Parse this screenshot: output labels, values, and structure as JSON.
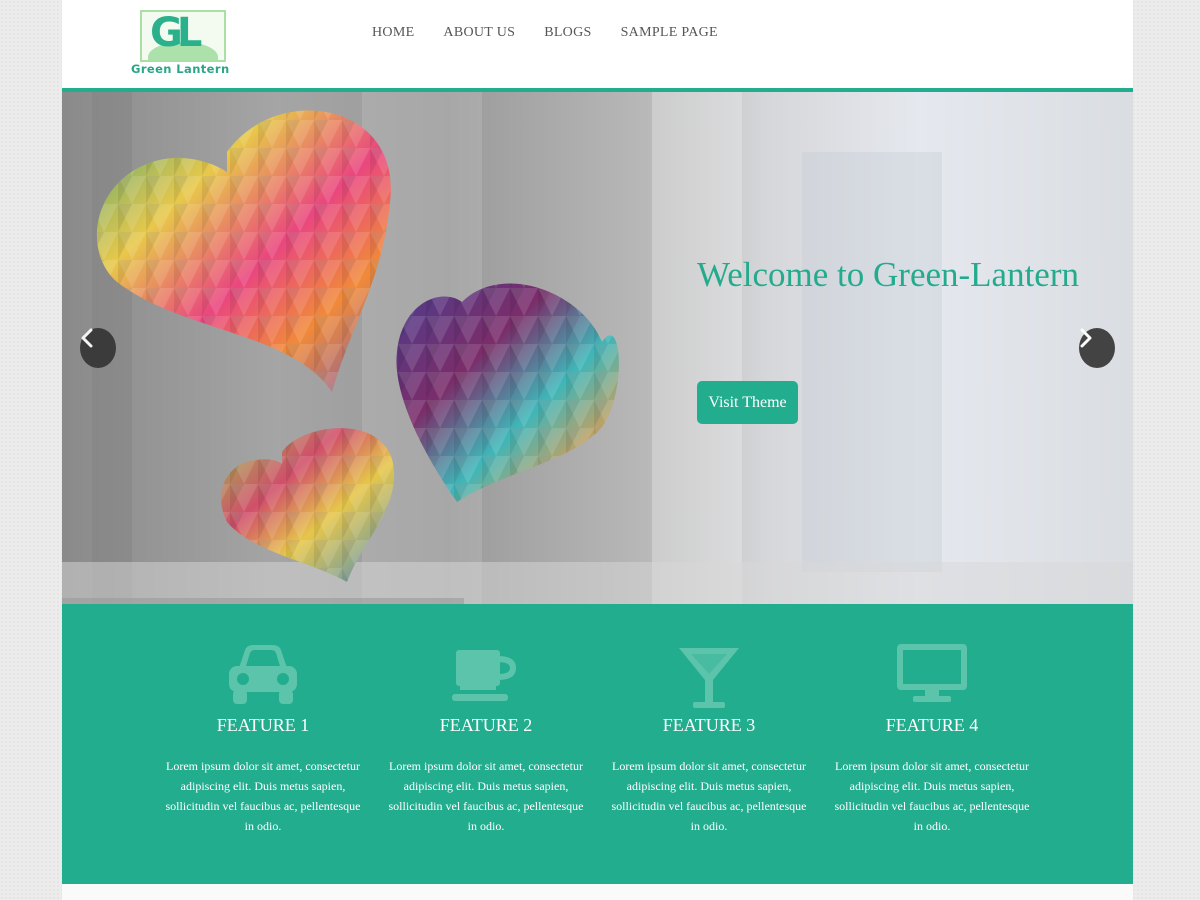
{
  "logo": {
    "letters": "GL",
    "text": "Green Lantern"
  },
  "nav": {
    "items": [
      "HOME",
      "ABOUT US",
      "BLOGS",
      "SAMPLE PAGE"
    ]
  },
  "hero": {
    "title": "Welcome to Green-Lantern",
    "button_label": "Visit Theme"
  },
  "features": [
    {
      "icon": "car-icon",
      "title": "FEATURE 1",
      "text": "Lorem ipsum dolor sit amet, consectetur adipiscing elit. Duis metus sapien, sollicitudin vel faucibus ac, pellentesque in odio."
    },
    {
      "icon": "coffee-cup-icon",
      "title": "FEATURE 2",
      "text": "Lorem ipsum dolor sit amet, consectetur adipiscing elit. Duis metus sapien, sollicitudin vel faucibus ac, pellentesque in odio."
    },
    {
      "icon": "cocktail-glass-icon",
      "title": "FEATURE 3",
      "text": "Lorem ipsum dolor sit amet, consectetur adipiscing elit. Duis metus sapien, sollicitudin vel faucibus ac, pellentesque in odio."
    },
    {
      "icon": "monitor-icon",
      "title": "FEATURE 4",
      "text": "Lorem ipsum dolor sit amet, consectetur adipiscing elit. Duis metus sapien, sollicitudin vel faucibus ac, pellentesque in odio."
    }
  ],
  "colors": {
    "accent": "#22ad8f",
    "title_text": "#24ab8e",
    "nav_text": "#555555"
  }
}
